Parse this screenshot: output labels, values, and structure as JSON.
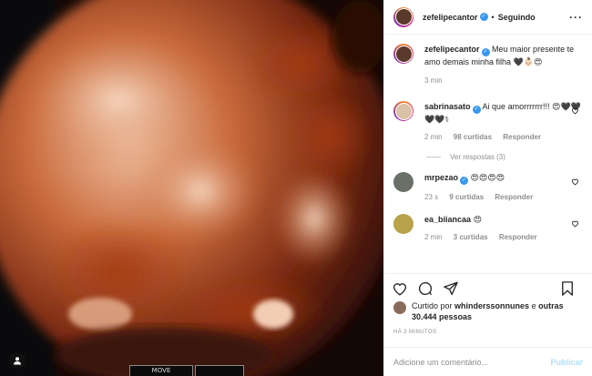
{
  "post": {
    "author": "zefelipecantor",
    "follow_state": "Seguindo",
    "separator": "•",
    "caption_author": "zefelipecantor",
    "caption_text": "Meu maior presente te amo demais minha filha 🖤👶🏻😍",
    "caption_time": "3 min",
    "image_overlay": {
      "screen_labels": [
        "MOVE"
      ]
    }
  },
  "comments": [
    {
      "username": "sabrinasato",
      "verified": true,
      "text": "Ai que amorrrrrrr!!! 😍🖤🖤🖤🖤⚕",
      "time": "2 min",
      "likes": "98 curtidas",
      "reply": "Responder",
      "view_replies": "Ver respostas (3)"
    },
    {
      "username": "mrpezao",
      "verified": true,
      "text": "😍😍😍😍",
      "time": "23 s",
      "likes": "9 curtidas",
      "reply": "Responder"
    },
    {
      "username": "ea_biiancaa",
      "verified": false,
      "text": "😍",
      "time": "2 min",
      "likes": "3 curtidas",
      "reply": "Responder"
    }
  ],
  "likes_summary": {
    "prefix": "Curtido por",
    "user": "whinderssonnunes",
    "conj": "e",
    "others": "outras 30.444 pessoas"
  },
  "posted_ago": "HÁ 3 MINUTOS",
  "add_comment": {
    "placeholder": "Adicione um comentário...",
    "publish": "Publicar"
  },
  "icons": [
    "heart-icon",
    "comment-icon",
    "share-icon",
    "save-icon",
    "more-icon",
    "verified-icon"
  ],
  "colors": {
    "verified": "#3897f0",
    "publish_disabled": "#b2dffc",
    "meta_text": "#8e8e8e"
  }
}
